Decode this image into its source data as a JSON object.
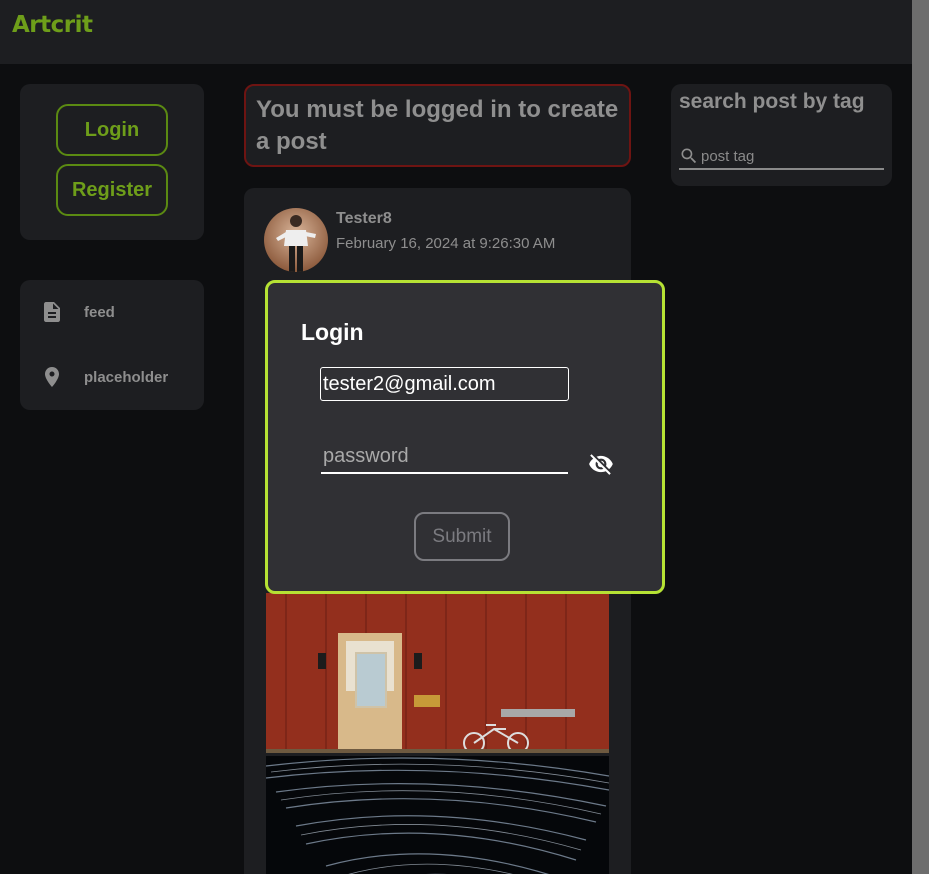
{
  "app": {
    "brand": "Artcrit"
  },
  "auth": {
    "login_label": "Login",
    "register_label": "Register"
  },
  "nav": {
    "items": [
      {
        "label": "feed",
        "icon": "document-icon"
      },
      {
        "label": "placeholder",
        "icon": "location-pin-icon"
      }
    ]
  },
  "notice": {
    "text": "You must be logged in to create a post"
  },
  "post": {
    "username": "Tester8",
    "date": "February 16, 2024 at 9:26:30 AM"
  },
  "search": {
    "title": "search post by tag",
    "placeholder": "post tag"
  },
  "login_modal": {
    "title": "Login",
    "email_value": "tester2@gmail.com",
    "password_placeholder": "password",
    "submit_label": "Submit"
  },
  "colors": {
    "accent": "#6e9e1a",
    "modal_border": "#b6e234",
    "notice_border": "#6e1412",
    "background": "#0d0e10",
    "card": "#1d1e21"
  }
}
